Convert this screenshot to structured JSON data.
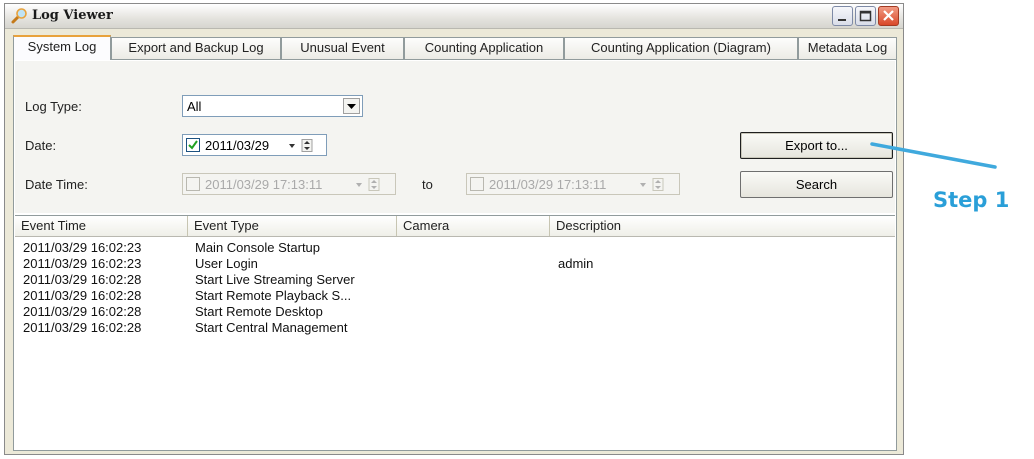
{
  "window": {
    "title": "Log Viewer"
  },
  "tabs": [
    {
      "label": "System Log",
      "active": true
    },
    {
      "label": "Export and Backup Log"
    },
    {
      "label": "Unusual Event"
    },
    {
      "label": "Counting Application"
    },
    {
      "label": "Counting Application (Diagram)"
    },
    {
      "label": "Metadata Log"
    }
  ],
  "filters": {
    "log_type_label": "Log Type:",
    "log_type_value": "All",
    "date_label": "Date:",
    "date_value": "2011/03/29",
    "date_checked": true,
    "datetime_label": "Date Time:",
    "datetime_from": "2011/03/29 17:13:11",
    "to_label": "to",
    "datetime_to": "2011/03/29 17:13:11"
  },
  "buttons": {
    "export": "Export to...",
    "search": "Search"
  },
  "table": {
    "columns": [
      "Event Time",
      "Event Type",
      "Camera",
      "Description"
    ],
    "rows": [
      [
        "2011/03/29 16:02:23",
        "Main Console Startup",
        "",
        ""
      ],
      [
        "2011/03/29 16:02:23",
        "User Login",
        "",
        "admin"
      ],
      [
        "2011/03/29 16:02:28",
        "Start Live Streaming Server",
        "",
        ""
      ],
      [
        "2011/03/29 16:02:28",
        "Start Remote Playback S...",
        "",
        ""
      ],
      [
        "2011/03/29 16:02:28",
        "Start Remote Desktop",
        "",
        ""
      ],
      [
        "2011/03/29 16:02:28",
        "Start Central Management",
        "",
        ""
      ]
    ]
  },
  "annotation": {
    "label": "Step 1",
    "color": "#2a9fd8"
  }
}
